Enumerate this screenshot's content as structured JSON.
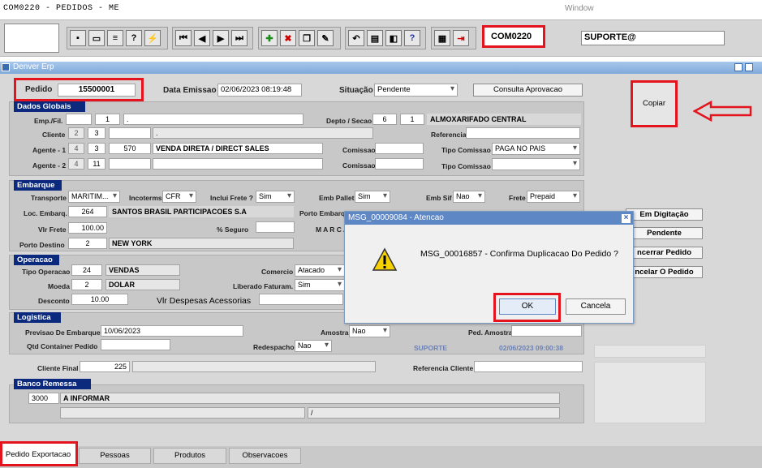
{
  "window": {
    "title": "COM0220 - PEDIDOS - ME",
    "menu": "Window",
    "app_title": "Denver Erp"
  },
  "toolbar": {
    "form_code": "COM0220",
    "user": "SUPORTE@"
  },
  "header": {
    "pedido_label": "Pedido",
    "pedido": "15500001",
    "data_emissao_label": "Data Emissao",
    "data_emissao": "02/06/2023 08:19:48",
    "situacao_label": "Situação",
    "situacao": "Pendente",
    "consulta_button": "Consulta Aprovacao"
  },
  "dados": {
    "title": "Dados Globais",
    "emp_label": "Emp./Fil.",
    "emp": "",
    "fil": "1",
    "emp_desc": ".",
    "depto_label": "Depto / Secao",
    "depto": "6",
    "secao": "1",
    "depto_desc": "ALMOXARIFADO CENTRAL",
    "cliente_label": "Cliente",
    "cliente1": "2",
    "cliente2": "3",
    "cliente_desc": ".",
    "referencia_label": "Referencia",
    "ag1_label": "Agente - 1",
    "ag1_a": "4",
    "ag1_b": "3",
    "ag1_c": "570",
    "ag1_desc": "VENDA DIRETA / DIRECT SALES",
    "comissao_label": "Comissao",
    "tipo_comissao_label": "Tipo Comissao",
    "tipo_comissao": "PAGA NO PAIS",
    "ag2_label": "Agente - 2",
    "ag2_a": "4",
    "ag2_b": "11"
  },
  "embarque": {
    "title": "Embarque",
    "transporte_label": "Transporte",
    "transporte": "MARITIM...",
    "incoterms_label": "Incoterms",
    "incoterms": "CFR",
    "inclui_frete_label": "Inclui Frete ?",
    "inclui_frete": "Sim",
    "emb_pallet_label": "Emb Pallet",
    "emb_pallet": "Sim",
    "emb_sif_label": "Emb Sif",
    "emb_sif": "Nao",
    "frete_label": "Frete",
    "frete": "Prepaid",
    "loc_label": "Loc. Embarq.",
    "loc_code": "264",
    "loc_desc": "SANTOS BRASIL PARTICIPACOES S.A",
    "porto_embarque_label": "Porto Embarq",
    "vlr_frete_label": "Vlr Frete",
    "vlr_frete": "100.00",
    "seguro_label": "% Seguro",
    "marca_label": "M A R C A",
    "porto_destino_label": "Porto Destino",
    "porto_destino_code": "2",
    "porto_destino": "NEW YORK"
  },
  "operacao": {
    "title": "Operacao",
    "tipo_label": "Tipo Operacao",
    "tipo_code": "24",
    "tipo": "VENDAS",
    "comercio_label": "Comercio",
    "comercio": "Atacado",
    "moeda_label": "Moeda",
    "moeda_code": "2",
    "moeda": "DOLAR",
    "liberado_label": "Liberado Faturam.",
    "liberado": "Sim",
    "desconto_label": "Desconto",
    "desconto": "10.00",
    "despesas_label": "Vlr Despesas Acessorias"
  },
  "logistica": {
    "title": "Logistica",
    "previsao_label": "Previsao De Embarque",
    "previsao": "10/06/2023",
    "amostra_label": "Amostra",
    "amostra": "Nao",
    "ped_amostra_label": "Ped. Amostra",
    "qtd_label": "Qtd Container Pedido",
    "redespacho_label": "Redespacho",
    "redespacho": "Nao",
    "audit_user": "SUPORTE",
    "audit_date": "02/06/2023 09:00:38"
  },
  "cliente_final": {
    "label": "Cliente Final",
    "code": "225",
    "ref_label": "Referencia Cliente"
  },
  "banco": {
    "title": "Banco Remessa",
    "code": "3000",
    "desc": "A INFORMAR",
    "slash": "/"
  },
  "side": {
    "copiar": "Copiar",
    "em_digitacao": "Em Digitação",
    "pendente": "Pendente",
    "encerrar": "ncerrar Pedido",
    "cancelar": "ncelar O Pedido"
  },
  "dialog": {
    "title": "MSG_00009084 - Atencao",
    "message": "MSG_00016857 - Confirma Duplicacao Do Pedido ?",
    "ok": "OK",
    "cancel": "Cancela"
  },
  "tabs": [
    "Pedido Exportacao",
    "Pessoas",
    "Produtos",
    "Observacoes"
  ],
  "colors": {
    "highlight": "#e3141d",
    "section_title": "#0b2a7e",
    "dialog_title": "#5d87c5"
  }
}
